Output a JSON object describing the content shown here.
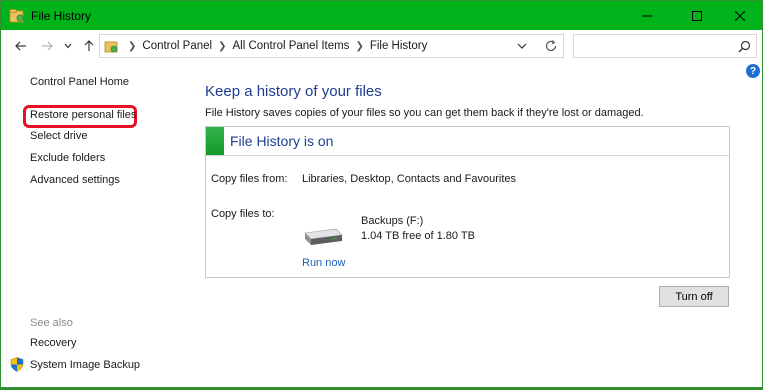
{
  "window": {
    "title": "File History",
    "accent_color": "#00b31a",
    "controls": {
      "minimize": "minimize-icon",
      "maximize": "maximize-icon",
      "close": "close-icon"
    }
  },
  "address_bar": {
    "breadcrumbs": [
      "Control Panel",
      "All Control Panel Items",
      "File History"
    ],
    "search_placeholder": ""
  },
  "help": {
    "label": "?"
  },
  "sidebar": {
    "home": "Control Panel Home",
    "items": [
      {
        "label": "Restore personal files",
        "highlighted": true
      },
      {
        "label": "Select drive"
      },
      {
        "label": "Exclude folders"
      },
      {
        "label": "Advanced settings"
      }
    ],
    "see_also": {
      "heading": "See also",
      "items": [
        {
          "label": "Recovery"
        },
        {
          "label": "System Image Backup",
          "icon": "shield-icon"
        }
      ]
    }
  },
  "main": {
    "heading": "Keep a history of your files",
    "description": "File History saves copies of your files so you can get them back if they're lost or damaged.",
    "status": {
      "title": "File History is on",
      "color": "#1aa232"
    },
    "copy_from": {
      "label": "Copy files from:",
      "value": "Libraries, Desktop, Contacts and Favourites"
    },
    "copy_to": {
      "label": "Copy files to:",
      "drive_name": "Backups (F:)",
      "drive_free": "1.04 TB free of 1.80 TB"
    },
    "run_now": "Run now",
    "turn_off": "Turn off"
  }
}
